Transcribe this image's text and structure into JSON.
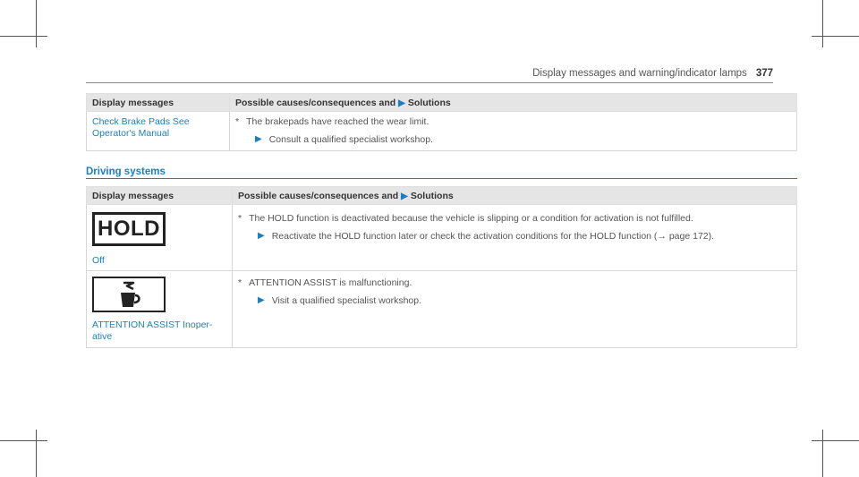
{
  "header": {
    "title": "Display messages and warning/indicator lamps",
    "page_number": "377"
  },
  "table1": {
    "col1_header": "Display messages",
    "col2_header": "Possible causes/consequences and",
    "col2_header_suffix": "Solutions",
    "rows": [
      {
        "message": "Check Brake Pads See Operator's Manual",
        "cause": "The brakepads have reached the wear limit.",
        "solution": "Consult a qualified specialist workshop."
      }
    ]
  },
  "section": {
    "title": "Driving systems"
  },
  "table2": {
    "col1_header": "Display messages",
    "col2_header": "Possible causes/consequences and",
    "col2_header_suffix": "Solutions",
    "rows": [
      {
        "icon_text": "HOLD",
        "message": "Off",
        "cause": "The HOLD function is deactivated because the vehicle is slipping or a condition for activation is not fulfilled.",
        "solution": "Reactivate the HOLD function later or check the activation conditions for the HOLD function (→ page 172)."
      },
      {
        "icon": "attention-assist-coffee-icon",
        "message": "ATTENTION ASSIST Inoper-ative",
        "cause": "ATTENTION ASSIST is malfunctioning.",
        "solution": "Visit a qualified specialist workshop."
      }
    ]
  },
  "symbols": {
    "bullet": "*",
    "arrow": "▶"
  },
  "colors": {
    "accent": "#1a7fc2",
    "header_bg": "#e5e5e5"
  }
}
